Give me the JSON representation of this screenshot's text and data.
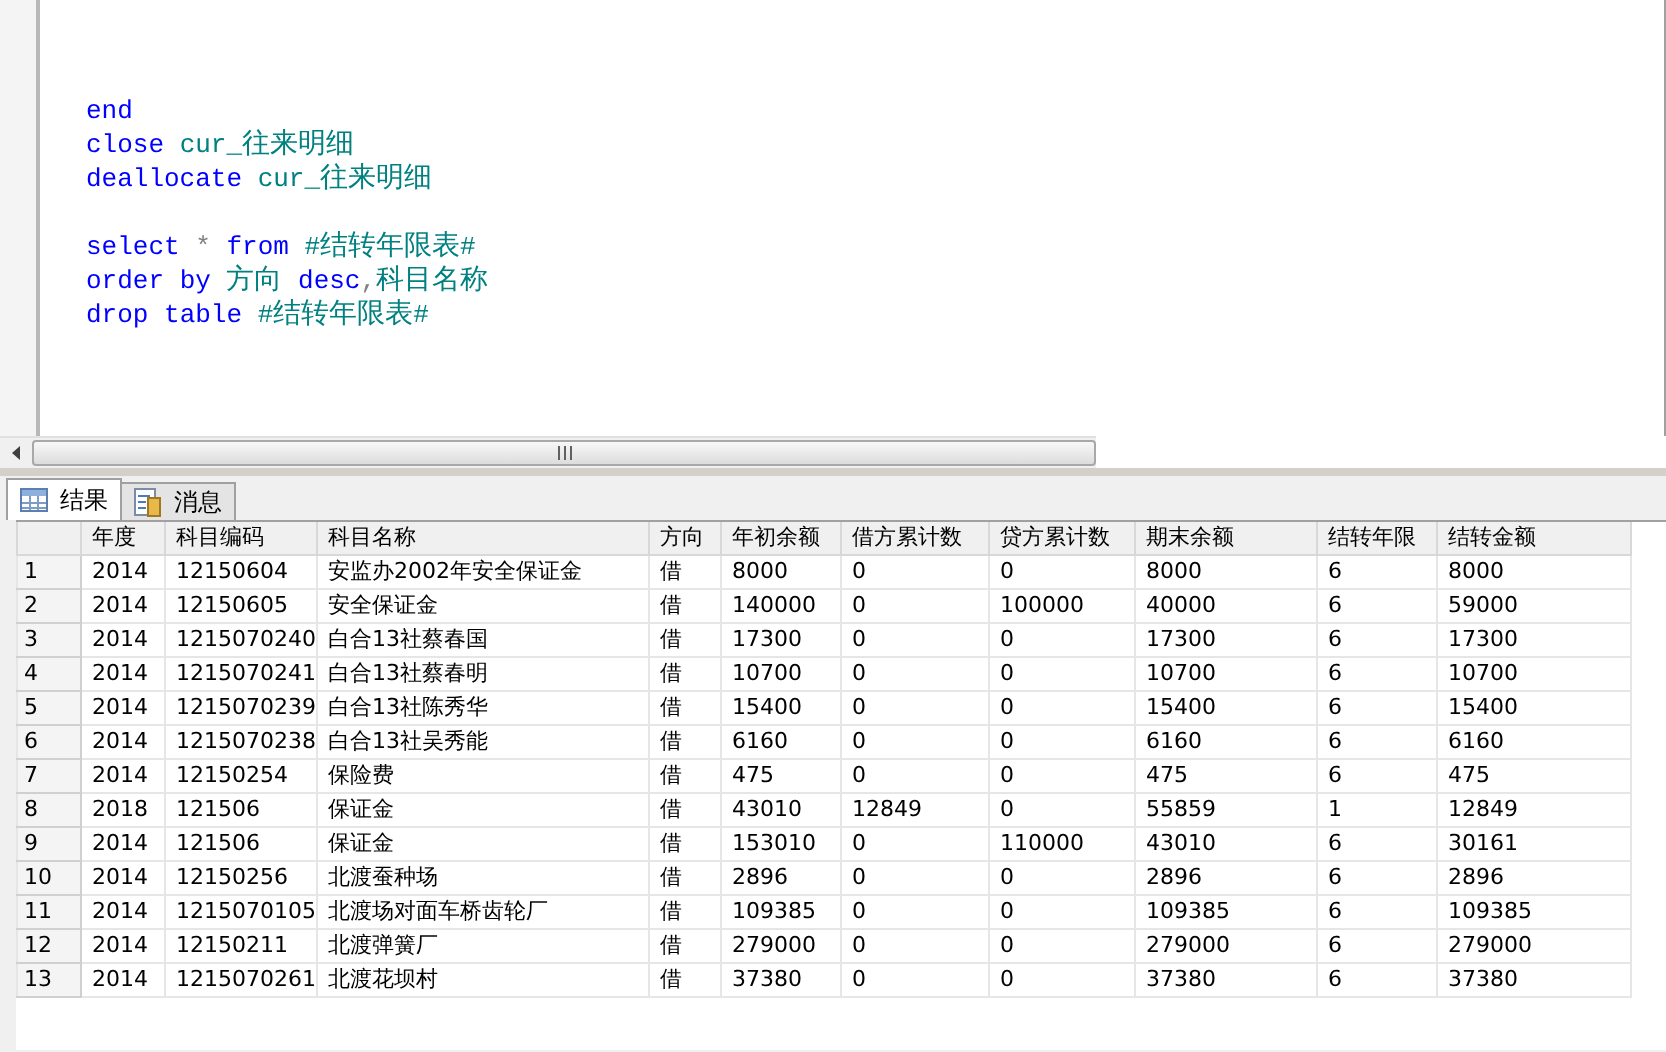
{
  "editor": {
    "blocks": [
      [
        [
          {
            "text": "end",
            "kind": "keyword"
          }
        ],
        [
          {
            "text": "close",
            "kind": "keyword"
          },
          {
            "text": "cur_往来明细",
            "kind": "ident"
          }
        ],
        [
          {
            "text": "deallocate",
            "kind": "keyword"
          },
          {
            "text": "cur_往来明细",
            "kind": "ident"
          }
        ]
      ],
      [
        [
          {
            "text": "select",
            "kind": "keyword"
          },
          {
            "text": "*",
            "kind": "operator"
          },
          {
            "text": "from",
            "kind": "keyword"
          },
          {
            "text": "#结转年限表#",
            "kind": "ident"
          }
        ],
        [
          {
            "text": "order",
            "kind": "keyword"
          },
          {
            "text": "by",
            "kind": "keyword"
          },
          {
            "text": "方向",
            "kind": "ident"
          },
          {
            "text": "desc",
            "kind": "keyword"
          },
          {
            "text": ",",
            "kind": "operator",
            "joined": true
          },
          {
            "text": "科目名称",
            "kind": "ident",
            "joined": true
          }
        ],
        [
          {
            "text": "drop",
            "kind": "keyword"
          },
          {
            "text": "table",
            "kind": "keyword"
          },
          {
            "text": "#结转年限表#",
            "kind": "ident"
          }
        ]
      ]
    ]
  },
  "tabs": [
    {
      "label": "结果",
      "selected": true
    },
    {
      "label": "消息",
      "selected": false
    }
  ],
  "table": {
    "columns": [
      "年度",
      "科目编码",
      "科目名称",
      "方向",
      "年初余额",
      "借方累计数",
      "贷方累计数",
      "期末余额",
      "结转年限",
      "结转金额"
    ],
    "rows": [
      {
        "number": "1",
        "cells": [
          "2014",
          "12150604",
          "安监办2002年安全保证金",
          "借",
          "8000",
          "0",
          "0",
          "8000",
          "6",
          "8000"
        ]
      },
      {
        "number": "2",
        "cells": [
          "2014",
          "12150605",
          "安全保证金",
          "借",
          "140000",
          "0",
          "100000",
          "40000",
          "6",
          "59000"
        ]
      },
      {
        "number": "3",
        "cells": [
          "2014",
          "1215070240",
          "白合13社蔡春国",
          "借",
          "17300",
          "0",
          "0",
          "17300",
          "6",
          "17300"
        ]
      },
      {
        "number": "4",
        "cells": [
          "2014",
          "1215070241",
          "白合13社蔡春明",
          "借",
          "10700",
          "0",
          "0",
          "10700",
          "6",
          "10700"
        ]
      },
      {
        "number": "5",
        "cells": [
          "2014",
          "1215070239",
          "白合13社陈秀华",
          "借",
          "15400",
          "0",
          "0",
          "15400",
          "6",
          "15400"
        ]
      },
      {
        "number": "6",
        "cells": [
          "2014",
          "1215070238",
          "白合13社吴秀能",
          "借",
          "6160",
          "0",
          "0",
          "6160",
          "6",
          "6160"
        ]
      },
      {
        "number": "7",
        "cells": [
          "2014",
          "12150254",
          "保险费",
          "借",
          "475",
          "0",
          "0",
          "475",
          "6",
          "475"
        ]
      },
      {
        "number": "8",
        "cells": [
          "2018",
          "121506",
          "保证金",
          "借",
          "43010",
          "12849",
          "0",
          "55859",
          "1",
          "12849"
        ]
      },
      {
        "number": "9",
        "cells": [
          "2014",
          "121506",
          "保证金",
          "借",
          "153010",
          "0",
          "110000",
          "43010",
          "6",
          "30161"
        ]
      },
      {
        "number": "10",
        "cells": [
          "2014",
          "12150256",
          "北渡蚕种场",
          "借",
          "2896",
          "0",
          "0",
          "2896",
          "6",
          "2896"
        ]
      },
      {
        "number": "11",
        "cells": [
          "2014",
          "1215070105",
          "北渡场对面车桥齿轮厂",
          "借",
          "109385",
          "0",
          "0",
          "109385",
          "6",
          "109385"
        ]
      },
      {
        "number": "12",
        "cells": [
          "2014",
          "12150211",
          "北渡弹簧厂",
          "借",
          "279000",
          "0",
          "0",
          "279000",
          "6",
          "279000"
        ]
      },
      {
        "number": "13",
        "cells": [
          "2014",
          "1215070261",
          "北渡花坝村",
          "借",
          "37380",
          "0",
          "0",
          "37380",
          "6",
          "37380"
        ]
      }
    ]
  }
}
